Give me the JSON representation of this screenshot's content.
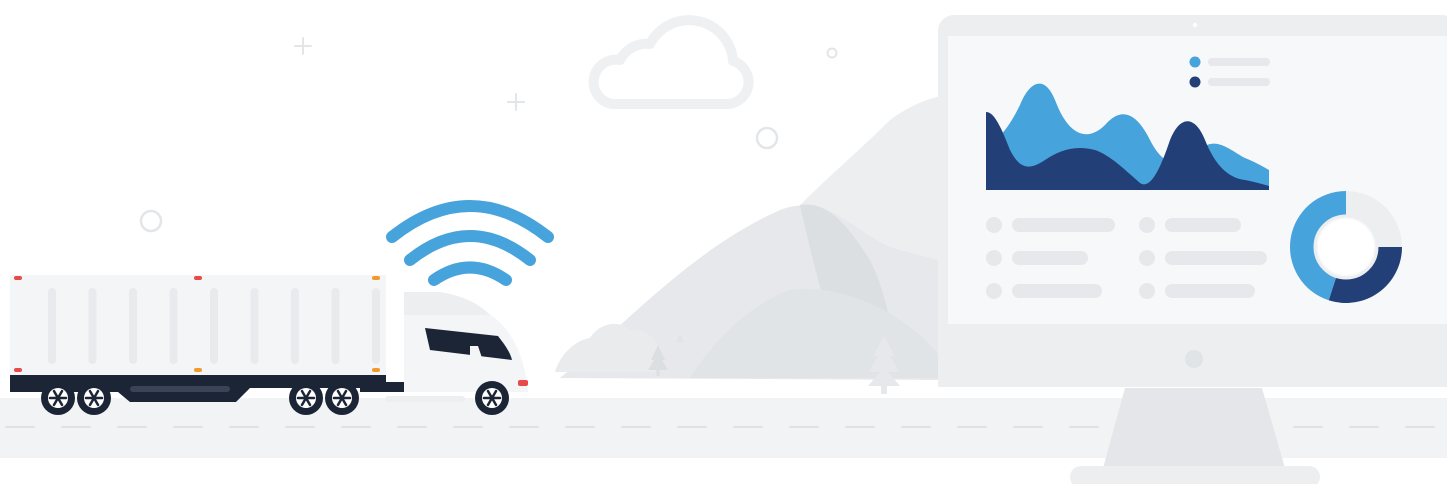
{
  "colors": {
    "background": "#ffffff",
    "road": "#f2f3f4",
    "road_dash": "#dfe2e5",
    "light_gray": "#eceef0",
    "mid_gray": "#e1e4e7",
    "mountain": "#e9ebed",
    "mountain_shadow": "#dcdfe2",
    "monitor_frame": "#eceef0",
    "monitor_screen": "#f7f8f9",
    "accent_light_blue": "#47a3dc",
    "accent_dark_blue": "#223f77",
    "truck_dark": "#1c2536",
    "truck_body": "#f4f5f6",
    "marker_red": "#e84a4a",
    "marker_orange": "#f39a2c"
  },
  "icons": {
    "wifi": "wifi-signal-icon",
    "cloud": "cloud-icon",
    "tree": "pine-tree-icon",
    "sparkle": "plus-sparkle-icon",
    "bubble": "circle-bubble-icon"
  },
  "monitor": {
    "legend_items": [
      {
        "color": "#47a3dc"
      },
      {
        "color": "#223f77"
      }
    ],
    "donut_shares": [
      0.25,
      0.3,
      0.45
    ]
  }
}
